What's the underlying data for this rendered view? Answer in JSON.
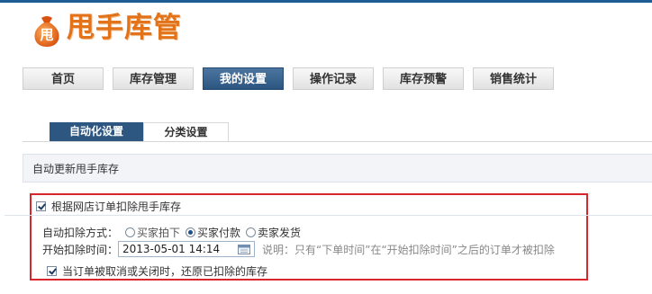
{
  "app": {
    "logo_text": "甩手库管",
    "logo_glyph": "甩"
  },
  "nav": {
    "items": [
      {
        "label": "首页",
        "active": false
      },
      {
        "label": "库存管理",
        "active": false
      },
      {
        "label": "我的设置",
        "active": true
      },
      {
        "label": "操作记录",
        "active": false
      },
      {
        "label": "库存预警",
        "active": false
      },
      {
        "label": "销售统计",
        "active": false
      }
    ]
  },
  "subtabs": [
    {
      "label": "自动化设置",
      "active": true
    },
    {
      "label": "分类设置",
      "active": false
    }
  ],
  "panel": {
    "title": "自动更新甩手库存",
    "main_checkbox_label": "根据网店订单扣除甩手库存",
    "main_checked": true,
    "deduct_mode_label": "自动扣除方式：",
    "deduct_options": [
      {
        "label": "买家拍下",
        "selected": false
      },
      {
        "label": "买家付款",
        "selected": true
      },
      {
        "label": "卖家发货",
        "selected": false
      }
    ],
    "start_time_label": "开始扣除时间：",
    "start_time_value": "2013-05-01 14:14",
    "start_time_note": "说明：只有“下单时间”在“开始扣除时间”之后的订单才被扣除",
    "restore_checkbox_label": "当订单被取消或关闭时，还原已扣除的库存",
    "restore_checked": true
  },
  "colors": {
    "brand_orange": "#e2731a",
    "nav_active": "#2c5480",
    "highlight_border": "#d9262c"
  }
}
